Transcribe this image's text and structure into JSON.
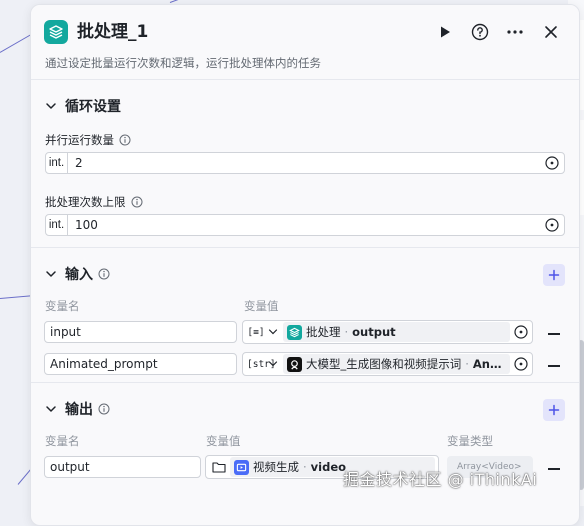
{
  "panel": {
    "title": "批处理_1",
    "description": "通过设定批量运行次数和逻辑，运行批处理体内的任务"
  },
  "loop_settings": {
    "title": "循环设置",
    "parallel_label": "并行运行数量",
    "parallel_type": "int.",
    "parallel_value": "2",
    "max_batch_label": "批处理次数上限",
    "max_batch_type": "int.",
    "max_batch_value": "100"
  },
  "inputs": {
    "title": "输入",
    "col_name": "变量名",
    "col_value": "变量值",
    "rows": [
      {
        "name": "input",
        "type_chip": "[≡]",
        "ref_node": "批处理",
        "ref_field": "output",
        "icon_color": "#13a89e"
      },
      {
        "name": "Animated_prompt",
        "type_chip": "[str]",
        "ref_node": "大模型_生成图像和视频提示词",
        "ref_field": "An…",
        "icon_color": "#111111"
      }
    ]
  },
  "outputs": {
    "title": "输出",
    "col_name": "变量名",
    "col_value": "变量值",
    "col_type": "变量类型",
    "rows": [
      {
        "name": "output",
        "ref_node": "视频生成",
        "ref_field": "video",
        "type_value": "Array<Video>",
        "icon_color": "#4a6cf7"
      }
    ]
  },
  "watermark": "掘金技术社区 @ iThinkAi",
  "colors": {
    "accent": "#13a89e",
    "add_button_bg": "#e3e4fb",
    "canvas_line": "#6b6fc9"
  }
}
